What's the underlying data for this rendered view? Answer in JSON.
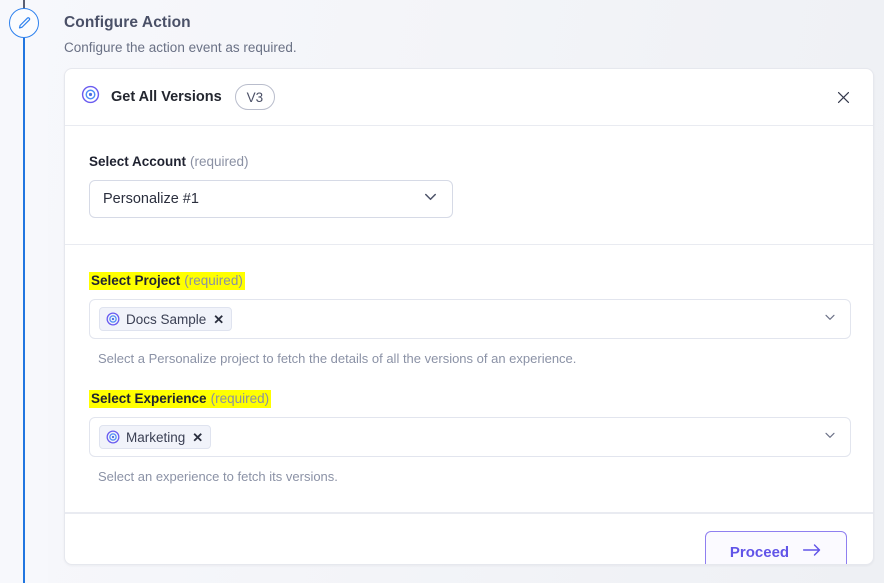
{
  "step": {
    "icon": "pencil-icon",
    "title": "Configure Action",
    "subtitle": "Configure the action event as required."
  },
  "card": {
    "header": {
      "icon": "bullseye-target-icon",
      "title": "Get All Versions",
      "version_badge": "V3",
      "close_icon": "close-icon"
    },
    "account_field": {
      "label": "Select Account",
      "required_text": "(required)",
      "highlighted": false,
      "selected_value": "Personalize #1",
      "chevron_icon": "chevron-down-icon"
    },
    "project_field": {
      "label": "Select Project",
      "required_text": "(required)",
      "highlighted": true,
      "chips": [
        {
          "icon": "bullseye-target-icon",
          "label": "Docs Sample",
          "remove_icon": "close-x-icon"
        }
      ],
      "help_text": "Select a Personalize project to fetch the details of all the versions of an experience.",
      "chevron_icon": "chevron-down-icon"
    },
    "experience_field": {
      "label": "Select Experience",
      "required_text": "(required)",
      "highlighted": true,
      "chips": [
        {
          "icon": "bullseye-target-icon",
          "label": "Marketing",
          "remove_icon": "close-x-icon"
        }
      ],
      "help_text": "Select an experience to fetch its versions.",
      "chevron_icon": "chevron-down-icon"
    },
    "footer": {
      "proceed_label": "Proceed",
      "proceed_icon": "arrow-right-icon"
    }
  },
  "colors": {
    "accent_purple": "#6154e8",
    "rail_blue": "#2176e0",
    "highlight_yellow": "#ffff00",
    "page_bg": "#f4f5f9",
    "card_bg": "#ffffff"
  }
}
